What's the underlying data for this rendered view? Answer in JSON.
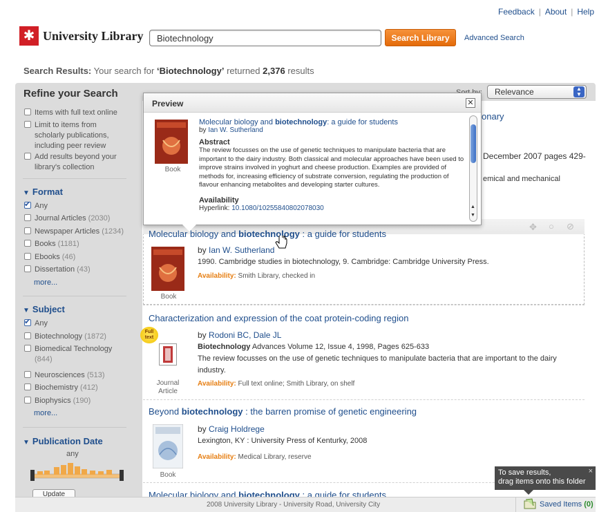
{
  "toplinks": {
    "feedback": "Feedback",
    "about": "About",
    "help": "Help"
  },
  "header": {
    "logo_text": "University Library",
    "search_value": "Biotechnology",
    "search_button": "Search Library",
    "advanced_search": "Advanced Search"
  },
  "summary": {
    "label": "Search Results:",
    "prefix": "Your search for",
    "term": "‘Biotechnology’",
    "middle": "returned",
    "count": "2,376",
    "suffix": "results"
  },
  "sidebar": {
    "title": "Refine your Search",
    "options": [
      "Items with full text online",
      "Limit to items from scholarly publications, including peer review",
      "Add results beyond your library's collection"
    ],
    "format": {
      "title": "Format",
      "items": [
        {
          "label": "Any",
          "count": "",
          "checked": true
        },
        {
          "label": "Journal Articles",
          "count": "(2030)"
        },
        {
          "label": "Newspaper Articles",
          "count": "(1234)"
        },
        {
          "label": "Books",
          "count": "(1181)"
        },
        {
          "label": "Ebooks",
          "count": "(46)"
        },
        {
          "label": "Dissertation",
          "count": "(43)"
        }
      ],
      "more": "more..."
    },
    "subject": {
      "title": "Subject",
      "items": [
        {
          "label": "Any",
          "count": "",
          "checked": true
        },
        {
          "label": "Biotechnology",
          "count": "(1872)"
        },
        {
          "label": "Biomedical Technology",
          "count": "(844)"
        },
        {
          "label": "Neurosciences",
          "count": "(513)"
        },
        {
          "label": "Biochemistry",
          "count": "(412)"
        },
        {
          "label": "Biophysics",
          "count": "(190)"
        }
      ],
      "more": "more..."
    },
    "pubdate": {
      "title": "Publication Date",
      "value": "any",
      "update": "Update"
    }
  },
  "sort": {
    "label": "Sort by:",
    "value": "Relevance"
  },
  "preview": {
    "title": "Preview",
    "item_title_pre": "Molecular biology and ",
    "item_title_bold": "biotechnology",
    "item_title_post": ": a guide for students",
    "author_prefix": "by",
    "author": "Ian W. Sutherland",
    "abstract_head": "Abstract",
    "abstract": "The review focusses on the use of genetic techniques to manipulate bacteria that are important to the dairy industry. Both classical and molecular approaches have been used to improve strains involved in yoghurt and cheese production. Examples are provided of methods for, increasing efficiency of substrate conversion, regulating the production of flavour enhancing metabolites and developing starter cultures.",
    "availability_head": "Availability",
    "hyperlink_label": "Hyperlink:",
    "hyperlink": "10.1080/10255840802078030",
    "format": "Book"
  },
  "behind_popup": {
    "title_tail": "onary",
    "line1": "December 2007 pages 429-",
    "line2": "emical and mechanical"
  },
  "results": [
    {
      "title_pre": "Molecular biology and ",
      "title_bold": "biotechnology",
      "title_post": " : a guide for students",
      "author_prefix": "by",
      "author": "Ian W. Sutherland",
      "details": "1990. Cambridge studies in biotechnology, 9. Cambridge: Cambridge University Press.",
      "avail_label": "Availability:",
      "avail": "Smith Library, checked in",
      "format": "Book"
    },
    {
      "title_pre": "Characterization and expression of the coat protein-coding region",
      "title_bold": "",
      "title_post": "",
      "author_prefix": "by",
      "author": "Rodoni BC, Dale JL",
      "journal_bold": "Biotechnology",
      "details": " Advances Volume 12, Issue 4, 1998, Pages 625-633",
      "abstract": "The review focusses on the use of genetic techniques to manipulate bacteria that are important to the dairy industry.",
      "avail_label": "Availability:",
      "avail": "Full text online; Smith Library, on shelf",
      "format": "Journal Article",
      "badge": "Full text"
    },
    {
      "title_pre": "Beyond ",
      "title_bold": "biotechnology",
      "title_post": " : the barren promise of genetic engineering",
      "author_prefix": "by",
      "author": "Craig Holdrege",
      "details": "Lexington, KY : University Press of Kenturky, 2008",
      "avail_label": "Availability:",
      "avail": "Medical Library, reserve",
      "format": "Book"
    },
    {
      "title_pre": "Molecular biology and ",
      "title_bold": "biotechnology",
      "title_post": " : a guide for students"
    }
  ],
  "footer": {
    "text": "2008 University Library - University Road, University City",
    "saved_label": "Saved Items",
    "saved_count": "(0)"
  },
  "tooltip": {
    "line1": "To save results,",
    "line2": "drag items onto this folder",
    "close": "×"
  },
  "colors": {
    "accent_orange": "#e67e12",
    "link_blue": "#1f4e8c",
    "brand_red": "#d11f26"
  }
}
